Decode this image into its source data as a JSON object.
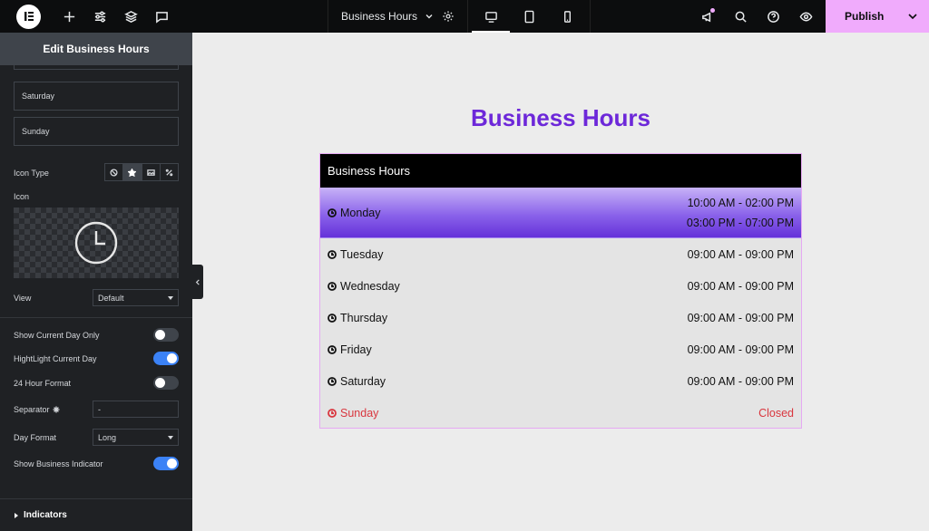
{
  "topbar": {
    "document_title": "Business Hours",
    "publish_label": "Publish",
    "accent_color": "#f0abfc"
  },
  "panel": {
    "title": "Edit Business Hours",
    "day_items": [
      "Saturday",
      "Sunday"
    ],
    "icon_type_label": "Icon Type",
    "icon_type_options": [
      "none-icon",
      "star-icon",
      "image-icon",
      "svg-icon"
    ],
    "icon_type_selected": "star-icon",
    "icon_label": "Icon",
    "icon_selected": "clock-icon",
    "view_label": "View",
    "view_value": "Default",
    "show_current_day_only_label": "Show Current Day Only",
    "show_current_day_only": false,
    "highlight_current_day_label": "HightLight Current Day",
    "highlight_current_day": true,
    "hour_format_label": "24 Hour Format",
    "hour_format_24": false,
    "separator_label": "Separator",
    "separator_value": "-",
    "day_format_label": "Day Format",
    "day_format_value": "Long",
    "show_business_indicator_label": "Show Business Indicator",
    "show_business_indicator": true,
    "indicators_section_label": "Indicators"
  },
  "canvas": {
    "page_heading": "Business Hours",
    "heading_color": "#6d28d9",
    "widget": {
      "header": "Business Hours",
      "rows": [
        {
          "day": "Monday",
          "hours": [
            "10:00 AM - 02:00 PM",
            "03:00 PM - 07:00 PM"
          ],
          "current": true
        },
        {
          "day": "Tuesday",
          "hours": [
            "09:00 AM - 09:00 PM"
          ]
        },
        {
          "day": "Wednesday",
          "hours": [
            "09:00 AM - 09:00 PM"
          ]
        },
        {
          "day": "Thursday",
          "hours": [
            "09:00 AM - 09:00 PM"
          ]
        },
        {
          "day": "Friday",
          "hours": [
            "09:00 AM - 09:00 PM"
          ]
        },
        {
          "day": "Saturday",
          "hours": [
            "09:00 AM - 09:00 PM"
          ]
        },
        {
          "day": "Sunday",
          "hours": [
            "Closed"
          ],
          "closed": true
        }
      ],
      "closed_color": "#d9363e"
    }
  }
}
